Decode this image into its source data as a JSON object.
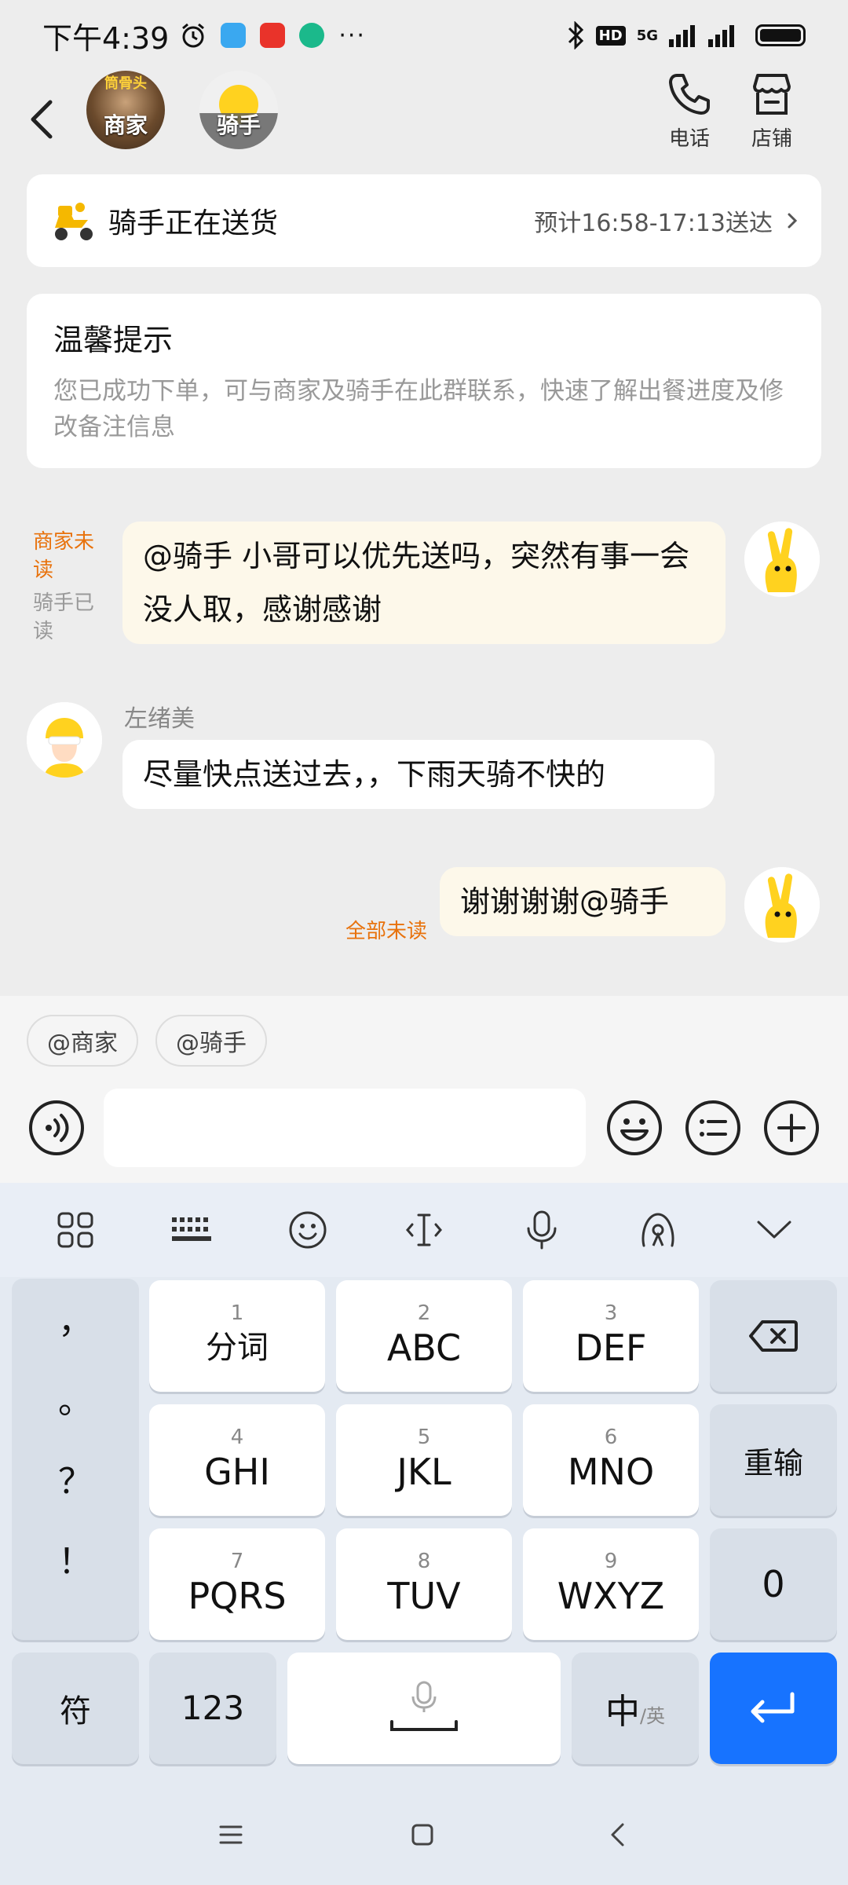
{
  "status_bar": {
    "time": "下午4:39",
    "network": "5G",
    "hd": "HD",
    "more": "···"
  },
  "header": {
    "merchant_avatar_label": "商家",
    "merchant_avatar_top": "筒骨头",
    "rider_avatar_label": "骑手",
    "phone_label": "电话",
    "store_label": "店铺"
  },
  "delivery": {
    "status": "骑手正在送货",
    "eta": "预计16:58-17:13送达"
  },
  "tips": {
    "title": "温馨提示",
    "body": "您已成功下单，可与商家及骑手在此群联系，快速了解出餐进度及修改备注信息"
  },
  "messages": [
    {
      "side": "right",
      "read_primary": "商家未读",
      "read_secondary": "骑手已读",
      "text": "@骑手 小哥可以优先送吗，突然有事一会没人取，感谢感谢"
    },
    {
      "side": "left",
      "sender": "左绪美",
      "text": "尽量快点送过去，，下雨天骑不快的"
    },
    {
      "side": "right",
      "read_primary": "全部未读",
      "text": "谢谢谢谢@骑手"
    }
  ],
  "mentions": [
    "@商家",
    "@骑手"
  ],
  "input": {
    "placeholder": "",
    "value": ""
  },
  "keyboard": {
    "punctuation": [
      "，",
      "。",
      "？",
      "！"
    ],
    "keys": [
      {
        "num": "1",
        "label": "分词"
      },
      {
        "num": "2",
        "label": "ABC"
      },
      {
        "num": "3",
        "label": "DEF"
      },
      {
        "num": "4",
        "label": "GHI"
      },
      {
        "num": "5",
        "label": "JKL"
      },
      {
        "num": "6",
        "label": "MNO"
      },
      {
        "num": "7",
        "label": "PQRS"
      },
      {
        "num": "8",
        "label": "TUV"
      },
      {
        "num": "9",
        "label": "WXYZ"
      }
    ],
    "reenter": "重输",
    "zero": "0",
    "symbols": "符",
    "numbers": "123",
    "lang_main": "中",
    "lang_sub": "/英"
  },
  "colors": {
    "accent_orange": "#e8720c",
    "enter_blue": "#1773ff",
    "bubble_yellow": "#fdf8ea"
  }
}
